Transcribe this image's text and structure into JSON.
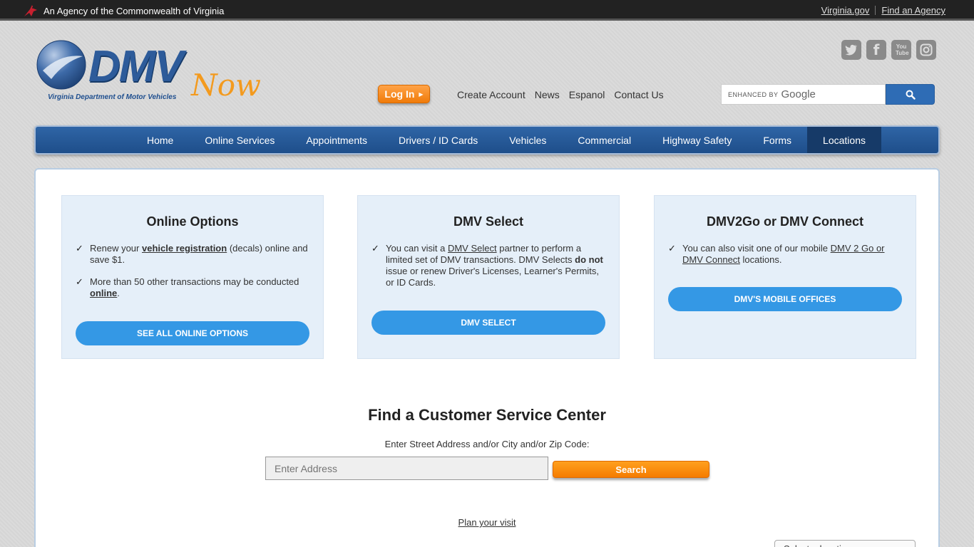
{
  "topbar": {
    "agency": "An Agency of the Commonwealth of Virginia",
    "links": [
      "Virginia.gov",
      "Find an Agency"
    ]
  },
  "logo": {
    "main": "DMV",
    "now": "Now",
    "tagline": "Virginia Department of Motor Vehicles"
  },
  "social": [
    "twitter-icon",
    "facebook-icon",
    "youtube-icon",
    "instagram-icon"
  ],
  "social_text": {
    "facebook": "f",
    "youtube": "You Tube"
  },
  "header": {
    "login": "Log In",
    "links": [
      "Create Account",
      "News",
      "Espanol",
      "Contact Us"
    ]
  },
  "search": {
    "enhanced": "ENHANCED BY",
    "google": "Google"
  },
  "nav": {
    "items": [
      "Home",
      "Online Services",
      "Appointments",
      "Drivers / ID Cards",
      "Vehicles",
      "Commercial",
      "Highway Safety",
      "Forms",
      "Locations"
    ],
    "active": "Locations"
  },
  "cards": [
    {
      "title": "Online Options",
      "b1_pre": "Renew your ",
      "b1_link": "vehicle registration",
      "b1_post": " (decals) online and save $1.",
      "b2_pre": "More than 50 other transactions may be conducted ",
      "b2_link": "online",
      "b2_post": ".",
      "button": "SEE ALL ONLINE OPTIONS"
    },
    {
      "title": "DMV Select",
      "b1_pre": "You can visit a ",
      "b1_link": "DMV Select",
      "b1_mid": " partner to perform a limited set of DMV transactions. DMV Selects ",
      "b1_bold": "do not",
      "b1_post": " issue or renew Driver's Licenses, Learner's Permits, or ID Cards.",
      "button": "DMV SELECT"
    },
    {
      "title": "DMV2Go or DMV Connect",
      "b1_pre": "You can also visit one of our mobile ",
      "b1_link": "DMV 2 Go or DMV Connect",
      "b1_post": " locations.",
      "button": "DMV'S MOBILE OFFICES"
    }
  ],
  "find": {
    "title": "Find a Customer Service Center",
    "label": "Enter Street Address and/or City and/or Zip Code:",
    "placeholder": "Enter Address",
    "button": "Search",
    "plan": "Plan your visit",
    "select": "Select a location"
  }
}
